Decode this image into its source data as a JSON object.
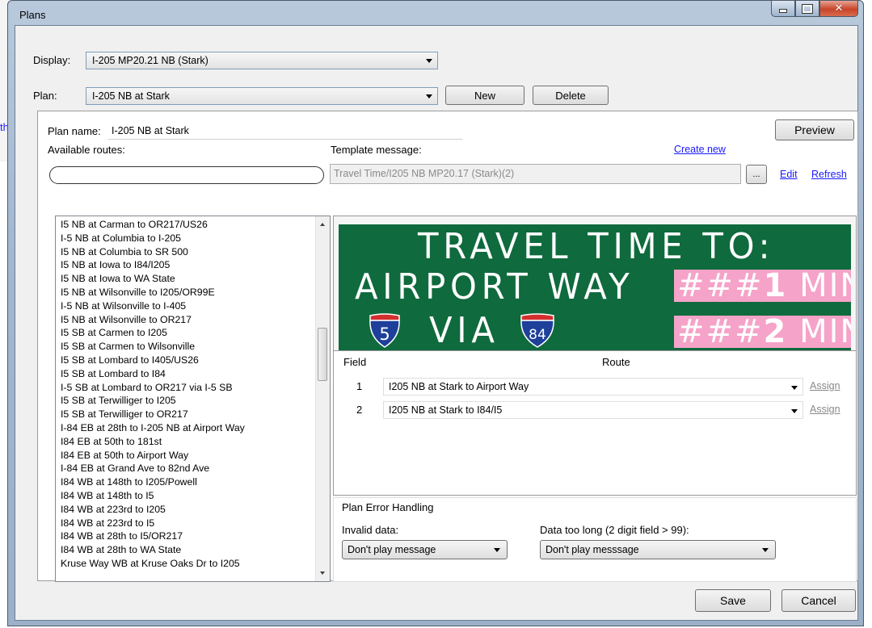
{
  "background": {
    "link_fragment": "th"
  },
  "window": {
    "title": "Plans",
    "buttons": {
      "minimize": "minimize-icon",
      "maximize": "maximize-icon",
      "close": "close-icon"
    }
  },
  "top": {
    "display_label": "Display:",
    "display_value": "I-205 MP20.21 NB (Stark)",
    "plan_label": "Plan:",
    "plan_value": "I-205 NB at Stark",
    "new_button": "New",
    "delete_button": "Delete"
  },
  "editor": {
    "plan_name_label": "Plan name:",
    "plan_name_value": "I-205 NB at Stark",
    "preview_button": "Preview",
    "available_routes_label": "Available routes:",
    "route_filter_value": "",
    "template_label": "Template message:",
    "create_new_link": "Create new",
    "template_value": "Travel Time/I205 NB MP20.17 (Stark)(2)",
    "browse_button": "...",
    "edit_link": "Edit",
    "refresh_link": "Refresh"
  },
  "routes": [
    "I5 NB at Carman to OR217/US26",
    "I-5 NB at Columbia to I-205",
    "I5 NB at Columbia to SR 500",
    "I5 NB at Iowa to I84/I205",
    "I5 NB at Iowa to WA State",
    "I5 NB at Wilsonville to I205/OR99E",
    "I-5 NB at Wilsonville to I-405",
    "I5 NB at Wilsonville to OR217",
    "I5 SB at Carmen to I205",
    "I5 SB at Carmen to Wilsonville",
    "I5 SB at Lombard to I405/US26",
    "I5 SB at Lombard to I84",
    "I-5 SB at Lombard to OR217 via I-5 SB",
    "I5 SB at Terwilliger to I205",
    "I5 SB at Terwilliger to OR217",
    "I-84 EB at 28th to I-205 NB at Airport Way",
    "I84 EB at 50th to 181st",
    "I84 EB at 50th to Airport Way",
    "I-84 EB at Grand Ave to 82nd Ave",
    "I84 WB at 148th to I205/Powell",
    "I84 WB at 148th to I5",
    "I84 WB at 223rd to I205",
    "I84 WB at 223rd to I5",
    "I84 WB at 28th to I5/OR217",
    "I84 WB at 28th to WA State",
    "Kruse Way WB at Kruse Oaks Dr to I205"
  ],
  "sign": {
    "background_color": "#0f6a3d",
    "placeholder_color": "#f5a3c8",
    "line1": "TRAVEL TIME TO:",
    "line2_text": "AIRPORT WAY",
    "line2_hashes": "###",
    "line2_field": "1",
    "line2_unit": "MIN",
    "line3_text": "VIA",
    "line3_hashes": "###",
    "line3_field": "2",
    "line3_unit": "MIN",
    "shield1": "5",
    "shield2": "84"
  },
  "field_table": {
    "field_header": "Field",
    "route_header": "Route",
    "rows": [
      {
        "field": "1",
        "route": "I205 NB at Stark to Airport Way",
        "assign": "Assign"
      },
      {
        "field": "2",
        "route": "I205 NB at Stark to I84/I5",
        "assign": "Assign"
      }
    ]
  },
  "error_handling": {
    "title": "Plan Error Handling",
    "invalid_label": "Invalid data:",
    "invalid_value": "Don't play message",
    "toolong_label": "Data too long (2 digit field > 99):",
    "toolong_value": "Don't play messsage"
  },
  "footer": {
    "save_button": "Save",
    "cancel_button": "Cancel"
  }
}
